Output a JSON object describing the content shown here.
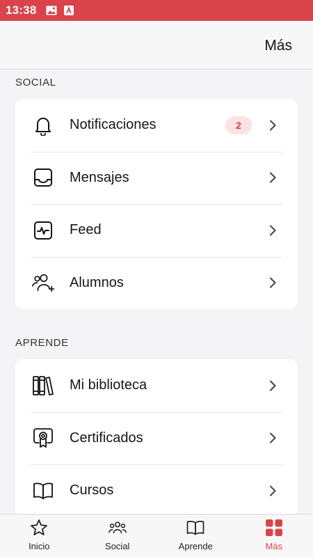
{
  "status_bar": {
    "time": "13:38"
  },
  "header": {
    "title": "Más"
  },
  "sections": [
    {
      "title": "SOCIAL",
      "items": [
        {
          "label": "Notificaciones",
          "icon": "bell-icon",
          "badge": "2"
        },
        {
          "label": "Mensajes",
          "icon": "inbox-icon"
        },
        {
          "label": "Feed",
          "icon": "activity-icon"
        },
        {
          "label": "Alumnos",
          "icon": "users-add-icon"
        }
      ]
    },
    {
      "title": "APRENDE",
      "items": [
        {
          "label": "Mi biblioteca",
          "icon": "library-icon"
        },
        {
          "label": "Certificados",
          "icon": "certificate-icon"
        },
        {
          "label": "Cursos",
          "icon": "book-icon"
        }
      ]
    }
  ],
  "tabbar": {
    "tabs": [
      {
        "label": "Inicio",
        "icon": "star-icon"
      },
      {
        "label": "Social",
        "icon": "group-icon"
      },
      {
        "label": "Aprende",
        "icon": "book-open-icon"
      },
      {
        "label": "Más",
        "icon": "grid-icon",
        "active": true
      }
    ]
  },
  "colors": {
    "accent": "#d9434a",
    "badge_bg": "#fbe3e3"
  }
}
